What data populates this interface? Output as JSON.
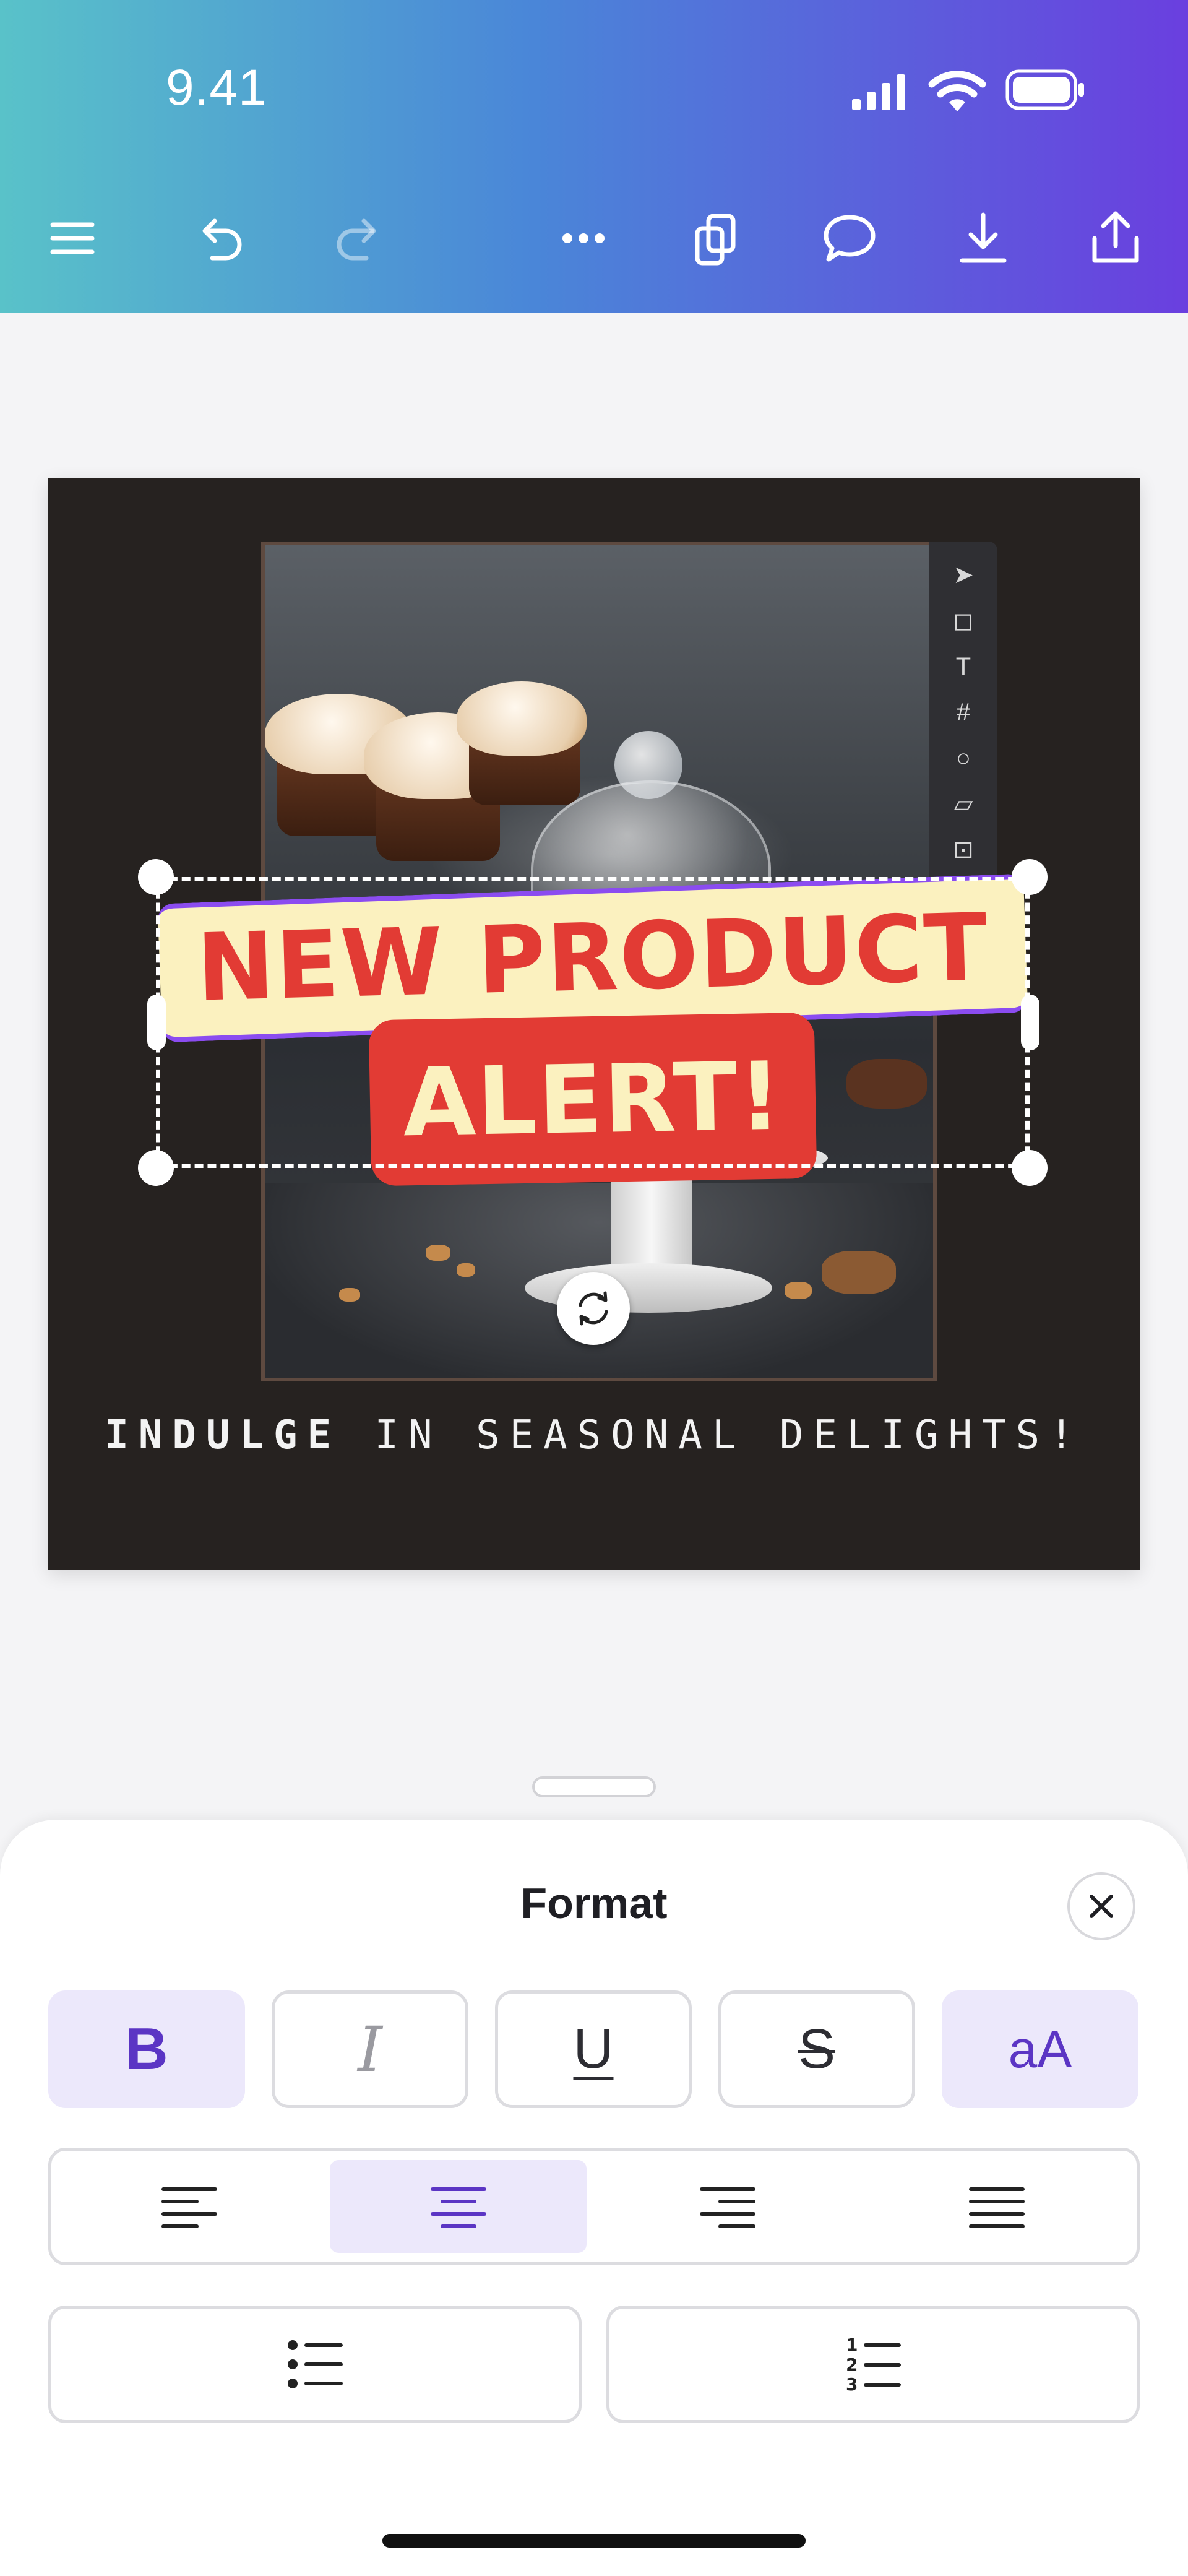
{
  "status_bar": {
    "time": "9.41",
    "icons": [
      "cellular-signal-icon",
      "wifi-icon",
      "battery-icon"
    ]
  },
  "toolbar": {
    "items": [
      "menu-icon",
      "undo-icon",
      "redo-icon",
      "more-icon",
      "pages-icon",
      "comment-icon",
      "download-icon",
      "share-icon"
    ]
  },
  "design": {
    "headline_line1": "NEW PRODUCT",
    "headline_line2": "ALERT!",
    "tagline_bold": "INDULGE",
    "tagline_rest": " IN SEASONAL DELIGHTS!",
    "colors": {
      "background": "#262220",
      "banner": "#fbf1bf",
      "accent_red": "#e23b34",
      "selection_purple": "#8b4cf0"
    }
  },
  "format_panel": {
    "title": "Format",
    "style_buttons": [
      {
        "label": "B",
        "name": "bold",
        "active": true
      },
      {
        "label": "I",
        "name": "italic",
        "active": false
      },
      {
        "label": "U",
        "name": "underline",
        "active": false
      },
      {
        "label": "S",
        "name": "strikethrough",
        "active": false
      },
      {
        "label": "aA",
        "name": "text-case",
        "active": true
      }
    ],
    "alignment": {
      "options": [
        "left",
        "center",
        "right",
        "justify"
      ],
      "selected": "center"
    },
    "lists": [
      "bulleted-list",
      "numbered-list"
    ]
  },
  "theme": {
    "accent": "#5b35c4",
    "active_bg": "#ece8fb"
  }
}
